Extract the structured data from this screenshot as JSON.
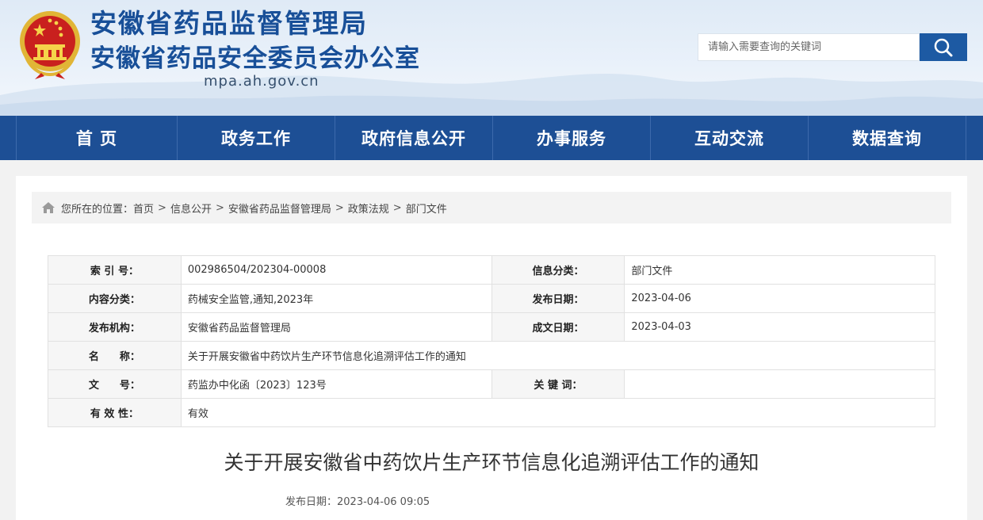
{
  "header": {
    "title_line1": "安徽省药品监督管理局",
    "title_line2": "安徽省药品安全委员会办公室",
    "domain": "mpa.ah.gov.cn",
    "emblem_icon": "national-emblem-icon",
    "search": {
      "placeholder": "请输入需要查询的关键词",
      "icon": "search-icon"
    },
    "colors": {
      "title": "#184f98",
      "nav": "#1d4f95",
      "search_button": "#1d5aa3"
    }
  },
  "nav": {
    "items": [
      {
        "label": "首 页"
      },
      {
        "label": "政务工作"
      },
      {
        "label": "政府信息公开"
      },
      {
        "label": "办事服务"
      },
      {
        "label": "互动交流"
      },
      {
        "label": "数据查询"
      }
    ]
  },
  "breadcrumb": {
    "icon": "home-icon",
    "prefix": "您所在的位置：",
    "items": [
      "首页",
      "信息公开",
      "安徽省药品监督管理局",
      "政策法规",
      "部门文件"
    ],
    "separator": ">"
  },
  "info": {
    "rows": [
      {
        "label1": "索 引 号：",
        "value1": "002986504/202304-00008",
        "label2": "信息分类：",
        "value2": "部门文件"
      },
      {
        "label1": "内容分类：",
        "value1": "药械安全监管,通知,2023年",
        "label2": "发布日期：",
        "value2": "2023-04-06"
      },
      {
        "label1": "发布机构：",
        "value1": "安徽省药品监督管理局",
        "label2": "成文日期：",
        "value2": "2023-04-03"
      },
      {
        "label1": "名　　称：",
        "value1": "关于开展安徽省中药饮片生产环节信息化追溯评估工作的通知"
      },
      {
        "label1": "文　　号：",
        "value1": "药监办中化函〔2023〕123号",
        "label2": "关 键 词：",
        "value2": ""
      },
      {
        "label1": "有 效 性：",
        "value1": "有效"
      }
    ]
  },
  "article": {
    "title": "关于开展安徽省中药饮片生产环节信息化追溯评估工作的通知",
    "publish": "发布日期：2023-04-06 09:05"
  }
}
